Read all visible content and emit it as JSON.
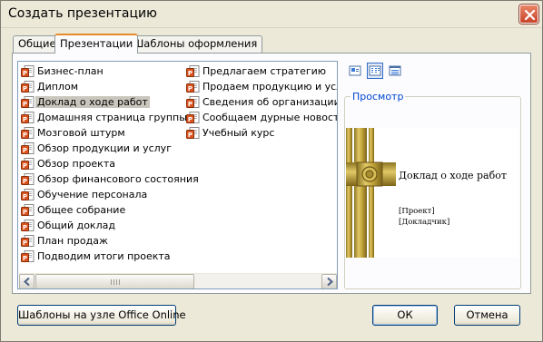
{
  "window": {
    "title": "Создать презентацию"
  },
  "tabs": [
    {
      "label": "Общие",
      "active": false
    },
    {
      "label": "Презентации",
      "active": true
    },
    {
      "label": "Шаблоны оформления",
      "active": false
    }
  ],
  "templates": {
    "column1": [
      "Бизнес-план",
      "Диплом",
      "Доклад о ходе работ",
      "Домашняя страница группы",
      "Мозговой штурм",
      "Обзор продукции и услуг",
      "Обзор проекта",
      "Обзор финансового состояния",
      "Обучение персонала",
      "Общее собрание",
      "Общий доклад",
      "План продаж",
      "Подводим итоги проекта"
    ],
    "column2": [
      "Предлагаем стратегию",
      "Продаем продукцию и услуги",
      "Сведения об организации",
      "Сообщаем дурные новости",
      "Учебный курс"
    ],
    "selected": "Доклад о ходе работ",
    "item_icon": "powerpoint-file-icon"
  },
  "view_buttons": [
    {
      "name": "large-icons-view",
      "icon": "large-icons-icon",
      "active": false
    },
    {
      "name": "list-view",
      "icon": "list-view-icon",
      "active": true
    },
    {
      "name": "details-view",
      "icon": "details-view-icon",
      "active": false
    }
  ],
  "preview": {
    "label": "Просмотр",
    "slide_title": "Доклад о ходе работ",
    "slide_line1": "[Проект]",
    "slide_line2": "[Докладчик]"
  },
  "buttons": {
    "online": "Шаблоны на узле Office Online",
    "ok": "ОК",
    "cancel": "Отмена"
  },
  "colors": {
    "dialog_bg": "#ece9d8",
    "accent_tab": "#e68b2c",
    "preview_label": "#0046d5",
    "button_border": "#003c74"
  }
}
